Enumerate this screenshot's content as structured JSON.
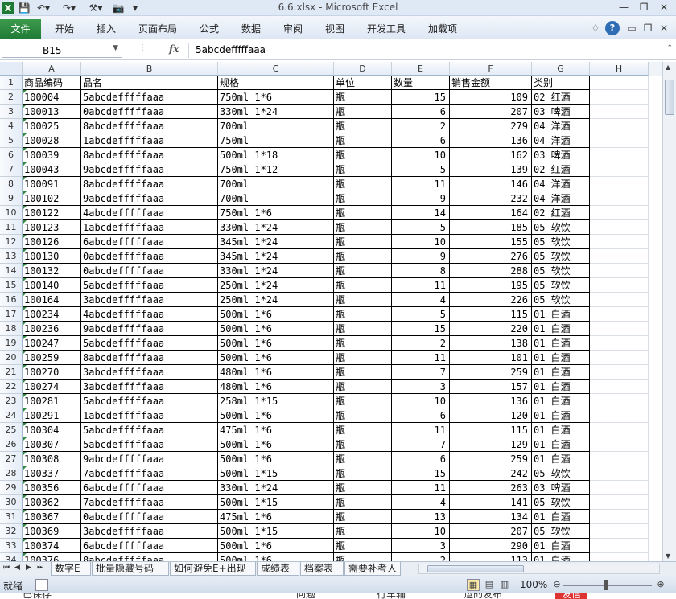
{
  "window": {
    "title": "6.6.xlsx - Microsoft Excel"
  },
  "quick_access": [
    "excel-logo-icon",
    "save-icon",
    "undo-icon",
    "redo-icon",
    "customize-icon",
    "camera-icon",
    "more-icon"
  ],
  "ribbon": {
    "file": "文件",
    "tabs": [
      "开始",
      "插入",
      "页面布局",
      "公式",
      "数据",
      "审阅",
      "视图",
      "开发工具",
      "加载项"
    ]
  },
  "formula_bar": {
    "name_box": "B15",
    "fx": "fx",
    "content": "5abcdefffffaaa"
  },
  "columns": [
    "A",
    "B",
    "C",
    "D",
    "E",
    "F",
    "G",
    "H"
  ],
  "headers": [
    "商品编码",
    "品名",
    "规格",
    "单位",
    "数量",
    "销售金额",
    "类别"
  ],
  "rows": [
    [
      "100004",
      "5abcdefffffaaa",
      "750ml 1*6",
      "瓶",
      "15",
      "109",
      "02 红酒"
    ],
    [
      "100013",
      "0abcdefffffaaa",
      "330ml 1*24",
      "瓶",
      "6",
      "207",
      "03 啤酒"
    ],
    [
      "100025",
      "8abcdefffffaaa",
      "700ml",
      "瓶",
      "2",
      "279",
      "04 洋酒"
    ],
    [
      "100028",
      "1abcdefffffaaa",
      "750ml",
      "瓶",
      "6",
      "136",
      "04 洋酒"
    ],
    [
      "100039",
      "8abcdefffffaaa",
      "500ml 1*18",
      "瓶",
      "10",
      "162",
      "03 啤酒"
    ],
    [
      "100043",
      "9abcdefffffaaa",
      "750ml 1*12",
      "瓶",
      "5",
      "139",
      "02 红酒"
    ],
    [
      "100091",
      "8abcdefffffaaa",
      "700ml",
      "瓶",
      "11",
      "146",
      "04 洋酒"
    ],
    [
      "100102",
      "9abcdefffffaaa",
      "700ml",
      "瓶",
      "9",
      "232",
      "04 洋酒"
    ],
    [
      "100122",
      "4abcdefffffaaa",
      "750ml 1*6",
      "瓶",
      "14",
      "164",
      "02 红酒"
    ],
    [
      "100123",
      "1abcdefffffaaa",
      "330ml 1*24",
      "瓶",
      "5",
      "185",
      "05 软饮"
    ],
    [
      "100126",
      "6abcdefffffaaa",
      "345ml 1*24",
      "瓶",
      "10",
      "155",
      "05 软饮"
    ],
    [
      "100130",
      "0abcdefffffaaa",
      "345ml 1*24",
      "瓶",
      "9",
      "276",
      "05 软饮"
    ],
    [
      "100132",
      "0abcdefffffaaa",
      "330ml 1*24",
      "瓶",
      "8",
      "288",
      "05 软饮"
    ],
    [
      "100140",
      "5abcdefffffaaa",
      "250ml 1*24",
      "瓶",
      "11",
      "195",
      "05 软饮"
    ],
    [
      "100164",
      "3abcdefffffaaa",
      "250ml 1*24",
      "瓶",
      "4",
      "226",
      "05 软饮"
    ],
    [
      "100234",
      "4abcdefffffaaa",
      "500ml 1*6",
      "瓶",
      "5",
      "115",
      "01 白酒"
    ],
    [
      "100236",
      "9abcdefffffaaa",
      "500ml 1*6",
      "瓶",
      "15",
      "220",
      "01 白酒"
    ],
    [
      "100247",
      "5abcdefffffaaa",
      "500ml 1*6",
      "瓶",
      "2",
      "138",
      "01 白酒"
    ],
    [
      "100259",
      "8abcdefffffaaa",
      "500ml 1*6",
      "瓶",
      "11",
      "101",
      "01 白酒"
    ],
    [
      "100270",
      "3abcdefffffaaa",
      "480ml 1*6",
      "瓶",
      "7",
      "259",
      "01 白酒"
    ],
    [
      "100274",
      "3abcdefffffaaa",
      "480ml 1*6",
      "瓶",
      "3",
      "157",
      "01 白酒"
    ],
    [
      "100281",
      "5abcdefffffaaa",
      "258ml 1*15",
      "瓶",
      "10",
      "136",
      "01 白酒"
    ],
    [
      "100291",
      "1abcdefffffaaa",
      "500ml 1*6",
      "瓶",
      "6",
      "120",
      "01 白酒"
    ],
    [
      "100304",
      "5abcdefffffaaa",
      "475ml 1*6",
      "瓶",
      "11",
      "115",
      "01 白酒"
    ],
    [
      "100307",
      "5abcdefffffaaa",
      "500ml 1*6",
      "瓶",
      "7",
      "129",
      "01 白酒"
    ],
    [
      "100308",
      "9abcdefffffaaa",
      "500ml 1*6",
      "瓶",
      "6",
      "259",
      "01 白酒"
    ],
    [
      "100337",
      "7abcdefffffaaa",
      "500ml 1*15",
      "瓶",
      "15",
      "242",
      "05 软饮"
    ],
    [
      "100356",
      "6abcdefffffaaa",
      "330ml 1*24",
      "瓶",
      "11",
      "263",
      "03 啤酒"
    ],
    [
      "100362",
      "7abcdefffffaaa",
      "500ml 1*15",
      "瓶",
      "4",
      "141",
      "05 软饮"
    ],
    [
      "100367",
      "0abcdefffffaaa",
      "475ml 1*6",
      "瓶",
      "13",
      "134",
      "01 白酒"
    ],
    [
      "100369",
      "3abcdefffffaaa",
      "500ml 1*15",
      "瓶",
      "10",
      "207",
      "05 软饮"
    ],
    [
      "100374",
      "6abcdefffffaaa",
      "500ml 1*6",
      "瓶",
      "3",
      "290",
      "01 白酒"
    ],
    [
      "100376",
      "8abcdefffffaaa",
      "500ml 1*6",
      "瓶",
      "2",
      "113",
      "01 白酒"
    ]
  ],
  "sheet_tabs": [
    "数字E",
    "批量隐藏号码",
    "如何避免E+出现",
    "成绩表",
    "档案表",
    "需要补考人"
  ],
  "status": {
    "text": "就绪",
    "zoom": "100%"
  },
  "taskbar_fragments": [
    "已保存",
    "问题",
    "行车辅",
    "运的发布",
    "发信"
  ]
}
